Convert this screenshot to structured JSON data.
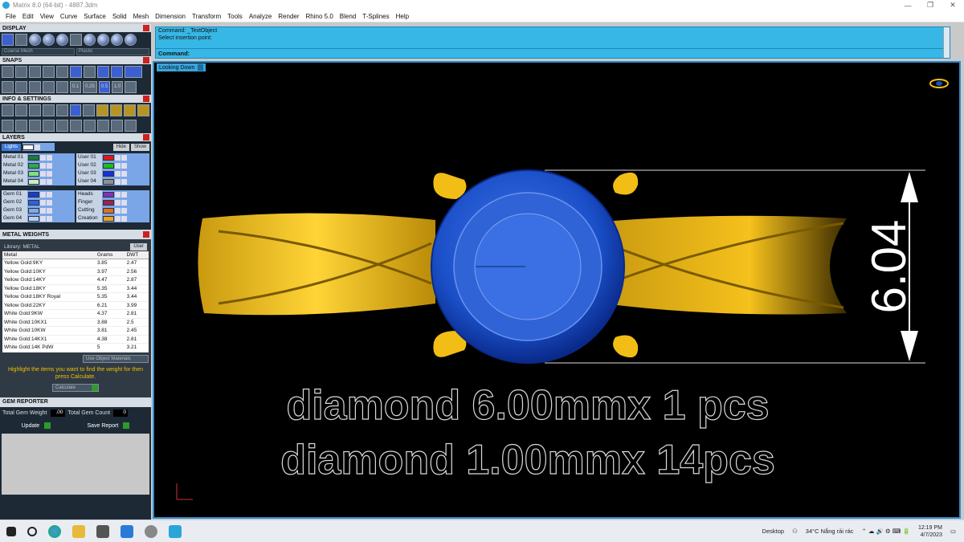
{
  "window": {
    "title": "Matrix 8.0 (64-bit) - 4887.3dm",
    "min": "—",
    "max": "❐",
    "close": "✕"
  },
  "menu": [
    "File",
    "Edit",
    "View",
    "Curve",
    "Surface",
    "Solid",
    "Mesh",
    "Dimension",
    "Transform",
    "Tools",
    "Analyze",
    "Render",
    "Rhino 5.0",
    "Blend",
    "T-Splines",
    "Help"
  ],
  "panels": {
    "display": {
      "title": "DISPLAY",
      "mesh_select": "Coarse Mesh",
      "material_select": "Plastic"
    },
    "snaps": {
      "title": "SNAPS",
      "values": [
        "0.1",
        "0.25",
        "0.5",
        "1.0"
      ]
    },
    "info": {
      "title": "INFO & SETTINGS"
    },
    "layers": {
      "title": "LAYERS",
      "lights": "Lights",
      "hide": "Hide",
      "show": "Show",
      "left": [
        {
          "name": "Metal 01",
          "color": "#1a7a3a"
        },
        {
          "name": "Metal 02",
          "color": "#2ea84a"
        },
        {
          "name": "Metal 03",
          "color": "#7ee07e"
        },
        {
          "name": "Metal 04",
          "color": "#c8f0c0"
        }
      ],
      "right": [
        {
          "name": "User 01",
          "color": "#e01818"
        },
        {
          "name": "User 02",
          "color": "#18c018"
        },
        {
          "name": "User 03",
          "color": "#1830d8"
        },
        {
          "name": "User 04",
          "color": "#909090"
        }
      ],
      "left2": [
        {
          "name": "Gem 01",
          "color": "#1a3ad0"
        },
        {
          "name": "Gem 02",
          "color": "#3060e0"
        },
        {
          "name": "Gem 03",
          "color": "#80a8f0"
        },
        {
          "name": "Gem 04",
          "color": "#b8d0f8"
        }
      ],
      "right2": [
        {
          "name": "Heads",
          "color": "#8030c0"
        },
        {
          "name": "Finger",
          "color": "#a02050"
        },
        {
          "name": "Cutting",
          "color": "#e07020"
        },
        {
          "name": "Creation",
          "color": "#f0a020"
        }
      ]
    },
    "metal_weights": {
      "title": "METAL WEIGHTS",
      "library_label": "Library: METAL",
      "user_btn": "User",
      "columns": [
        "Metal",
        "Grams",
        "DWT"
      ],
      "rows": [
        [
          "Yellow Gold:9KY",
          "3.85",
          "2.47"
        ],
        [
          "Yellow Gold:10KY",
          "3.97",
          "2.56"
        ],
        [
          "Yellow Gold:14KY",
          "4.47",
          "2.87"
        ],
        [
          "Yellow Gold:18KY",
          "5.35",
          "3.44"
        ],
        [
          "Yellow Gold:18KY Royal",
          "5.35",
          "3.44"
        ],
        [
          "Yellow Gold:22KY",
          "6.21",
          "3.99"
        ],
        [
          "White Gold:9KW",
          "4.37",
          "2.81"
        ],
        [
          "White Gold:10KX1",
          "3.88",
          "2.5"
        ],
        [
          "White Gold:10KW",
          "3.81",
          "2.45"
        ],
        [
          "White Gold:14KX1",
          "4.38",
          "2.81"
        ],
        [
          "White Gold:14K PdW",
          "5",
          "3.21"
        ]
      ],
      "use_object": "Use Object Materials",
      "note": "Highlight the items you want to find the weight for then press Calculate.",
      "calculate": "Calculate"
    },
    "gem_reporter": {
      "title": "GEM REPORTER",
      "total_weight_label": "Total Gem Weight",
      "total_weight": ".00",
      "total_count_label": "Total Gem Count",
      "total_count": "0",
      "update": "Update",
      "save_report": "Save Report"
    }
  },
  "command": {
    "line1": "Command: _TextObject",
    "line2": "Select insertion point:",
    "prompt": "Command:"
  },
  "viewport": {
    "label": "Looking Down",
    "dimension": "6.04",
    "text_line1": "diamond 6.00mmx 1 pcs",
    "text_line2": "diamond 1.00mmx 14pcs",
    "colors": {
      "gold": "#f2bd14",
      "stone": "#1a4fc8",
      "stone_dark": "#0a2a8a"
    }
  },
  "taskbar": {
    "desktop": "Desktop",
    "weather": "34°C  Nắng rải rác",
    "time": "12:19 PM",
    "date": "4/7/2023"
  }
}
